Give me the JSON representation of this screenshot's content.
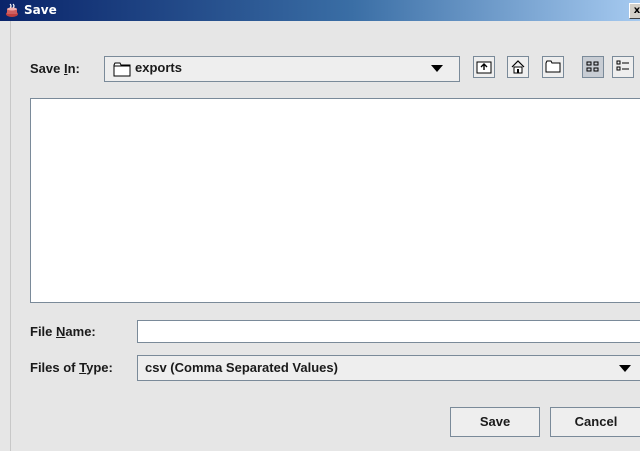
{
  "window": {
    "title": "Save",
    "close_glyph": "x"
  },
  "save_in": {
    "label_pre": "Save ",
    "label_mnemonic": "I",
    "label_post": "n:",
    "value": "exports",
    "icon": "folder-icon"
  },
  "toolbar": {
    "buttons": [
      {
        "name": "up-one-level",
        "icon": "folder-up-icon"
      },
      {
        "name": "home",
        "icon": "home-icon"
      },
      {
        "name": "new-folder",
        "icon": "new-folder-icon"
      },
      {
        "name": "list-view",
        "icon": "list-view-icon",
        "active": true
      },
      {
        "name": "details-view",
        "icon": "details-view-icon"
      }
    ]
  },
  "file_name": {
    "label_pre": "File ",
    "label_mnemonic": "N",
    "label_post": "ame:",
    "value": "",
    "placeholder": ""
  },
  "file_type": {
    "label_pre": "Files of ",
    "label_mnemonic": "T",
    "label_post": "ype:",
    "value": "csv (Comma Separated Values)"
  },
  "actions": {
    "save_label": "Save",
    "cancel_label": "Cancel"
  }
}
